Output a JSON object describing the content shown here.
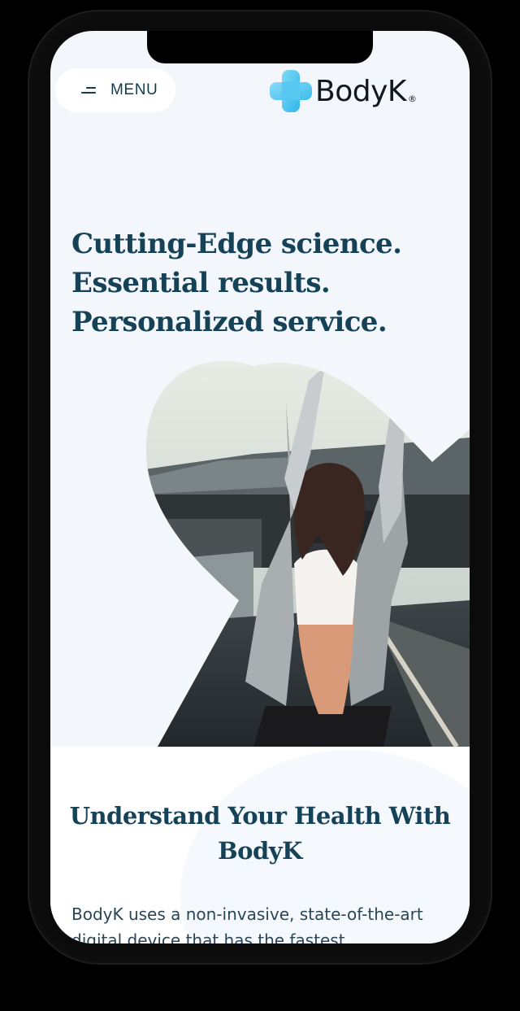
{
  "header": {
    "menu_label": "MENU",
    "logo_name": "BodyK",
    "logo_registered": "®",
    "logo_icon": "medical-cross-icon"
  },
  "hero": {
    "headline_lines": [
      "Cutting-Edge science.",
      "Essential results.",
      "Personalized service."
    ],
    "image_alt": "woman stretching arms overhead outdoors"
  },
  "intro": {
    "title": "Understand Your Health With BodyK",
    "body": "BodyK uses a non-invasive, state-of-the-art digital device that has the fastest"
  },
  "colors": {
    "brand_dark": "#164257",
    "brand_accent": "#3fc3f0",
    "page_bg": "#f3f6fb"
  }
}
